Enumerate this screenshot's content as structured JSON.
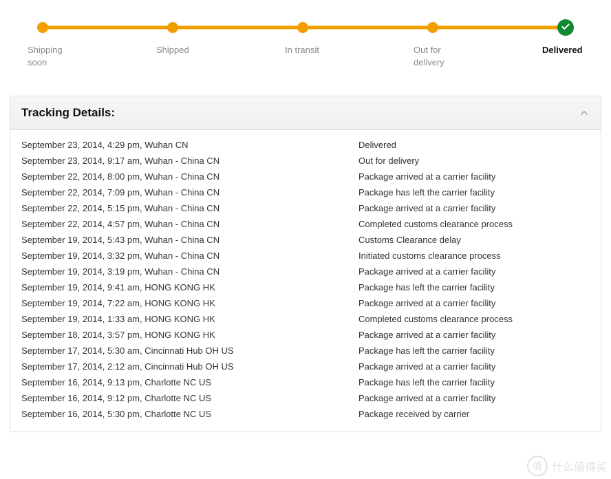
{
  "progress": {
    "steps": [
      {
        "label": "Shipping soon",
        "active": false
      },
      {
        "label": "Shipped",
        "active": false
      },
      {
        "label": "In transit",
        "active": false
      },
      {
        "label": "Out for delivery",
        "active": false
      },
      {
        "label": "Delivered",
        "active": true
      }
    ]
  },
  "tracking": {
    "title": "Tracking Details:",
    "rows": [
      {
        "left": "September 23, 2014, 4:29 pm, Wuhan CN",
        "right": "Delivered"
      },
      {
        "left": "September 23, 2014, 9:17 am, Wuhan - China CN",
        "right": "Out for delivery"
      },
      {
        "left": "September 22, 2014, 8:00 pm, Wuhan - China CN",
        "right": "Package arrived at a carrier facility"
      },
      {
        "left": "September 22, 2014, 7:09 pm, Wuhan - China CN",
        "right": "Package has left the carrier facility"
      },
      {
        "left": "September 22, 2014, 5:15 pm, Wuhan - China CN",
        "right": "Package arrived at a carrier facility"
      },
      {
        "left": "September 22, 2014, 4:57 pm, Wuhan - China CN",
        "right": "Completed customs clearance process"
      },
      {
        "left": "September 19, 2014, 5:43 pm, Wuhan - China CN",
        "right": "Customs Clearance delay"
      },
      {
        "left": "September 19, 2014, 3:32 pm, Wuhan - China CN",
        "right": "Initiated customs clearance process"
      },
      {
        "left": "September 19, 2014, 3:19 pm, Wuhan - China CN",
        "right": "Package arrived at a carrier facility"
      },
      {
        "left": "September 19, 2014, 9:41 am, HONG KONG HK",
        "right": "Package has left the carrier facility"
      },
      {
        "left": "September 19, 2014, 7:22 am, HONG KONG HK",
        "right": "Package arrived at a carrier facility"
      },
      {
        "left": "September 19, 2014, 1:33 am, HONG KONG HK",
        "right": "Completed customs clearance process"
      },
      {
        "left": "September 18, 2014, 3:57 pm, HONG KONG HK",
        "right": "Package arrived at a carrier facility"
      },
      {
        "left": "September 17, 2014, 5:30 am, Cincinnati Hub OH US",
        "right": "Package has left the carrier facility"
      },
      {
        "left": "September 17, 2014, 2:12 am, Cincinnati Hub OH US",
        "right": "Package arrived at a carrier facility"
      },
      {
        "left": "September 16, 2014, 9:13 pm, Charlotte NC US",
        "right": "Package has left the carrier facility"
      },
      {
        "left": "September 16, 2014, 9:12 pm, Charlotte NC US",
        "right": "Package arrived at a carrier facility"
      },
      {
        "left": "September 16, 2014, 5:30 pm, Charlotte NC US",
        "right": "Package received by carrier"
      }
    ]
  },
  "watermark": {
    "badge": "值",
    "text": "什么值得买"
  }
}
